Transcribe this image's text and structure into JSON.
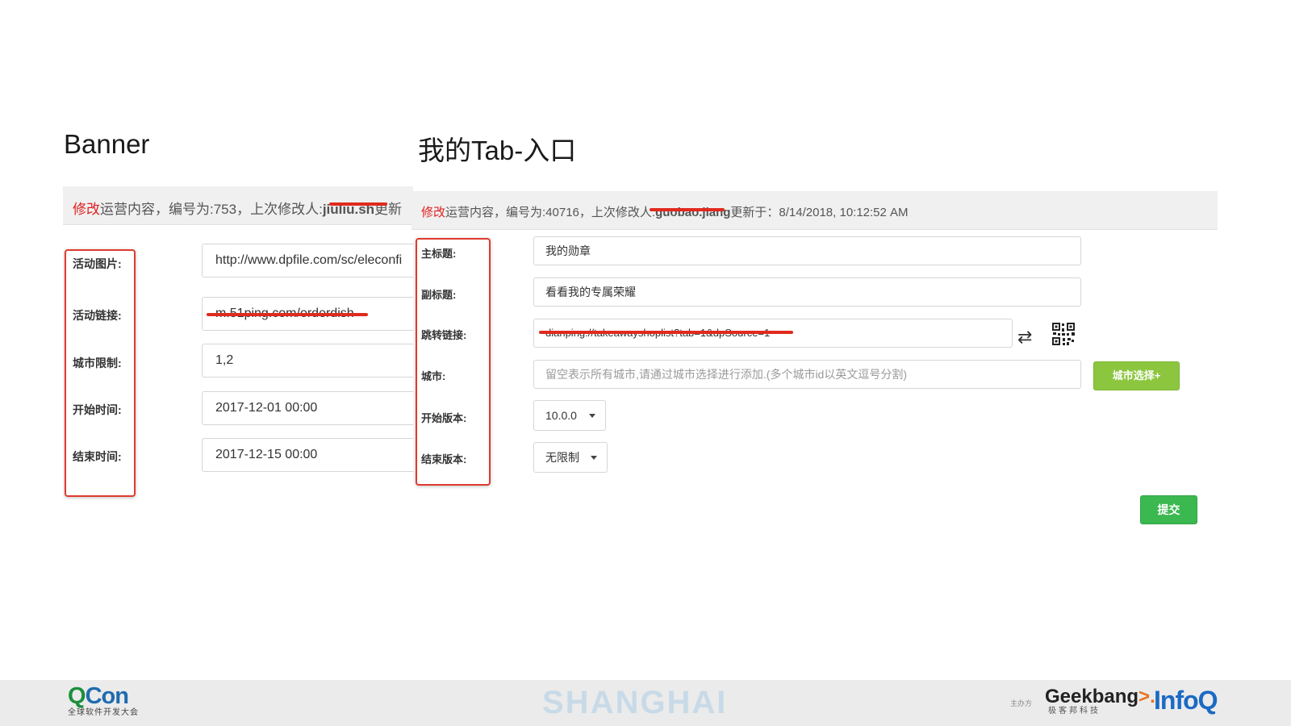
{
  "titles": {
    "left": "Banner",
    "right": "我的Tab-入口"
  },
  "left_panel": {
    "header": {
      "modify": "修改",
      "text": "运营内容，编号为:753，上次修改人:",
      "editor_redacted": "jiuliu.sh",
      "updated_prefix": "更新"
    },
    "fields": [
      {
        "label": "活动图片:",
        "value": "http://www.dpfile.com/sc/eleconfi"
      },
      {
        "label": "活动链接:",
        "value": "m.51ping.com/orderdish"
      },
      {
        "label": "城市限制:",
        "value": "1,2"
      },
      {
        "label": "开始时间:",
        "value": "2017-12-01 00:00"
      },
      {
        "label": "结束时间:",
        "value": "2017-12-15 00:00"
      }
    ]
  },
  "right_panel": {
    "header": {
      "modify": "修改",
      "text": "运营内容，编号为:40716，上次修改人:",
      "editor_redacted": "guobao.jiang",
      "updated": "更新于：8/14/2018, 10:12:52 AM"
    },
    "fields": {
      "main_title": {
        "label": "主标题:",
        "value": "我的勋章"
      },
      "sub_title": {
        "label": "副标题:",
        "value": "看看我的专属荣耀"
      },
      "link": {
        "label": "跳转链接:",
        "value": "dianping://takeawayshoplist?tab=1&dpSource=1"
      },
      "city": {
        "label": "城市:",
        "placeholder": "留空表示所有城市,请通过城市选择进行添加.(多个城市id以英文逗号分割)"
      },
      "start_version": {
        "label": "开始版本:",
        "value": "10.0.0"
      },
      "end_version": {
        "label": "结束版本:",
        "value": "无限制"
      }
    },
    "buttons": {
      "city_select": "城市选择+",
      "submit": "提交"
    },
    "icons": {
      "swap": "swap-icon",
      "qr": "qr-code-icon"
    }
  },
  "footer": {
    "qcon_q": "Q",
    "qcon_con": "Con",
    "qcon_sub": "全球软件开发大会",
    "city": "SHANGHAI",
    "organizer": "主办方",
    "geek_a": "Geekbang",
    "geek_arrow": ">.",
    "geek_sub": "极客邦科技",
    "infoq": "InfoQ"
  },
  "colors": {
    "modify_red": "#e01e1e",
    "highlight_box": "#e03a2e",
    "city_button": "#8cc63f",
    "submit_button": "#3bb84f",
    "qcon_green": "#1c8f3c",
    "qcon_blue": "#1f6bb0",
    "infoq_blue": "#1b6ac4"
  }
}
